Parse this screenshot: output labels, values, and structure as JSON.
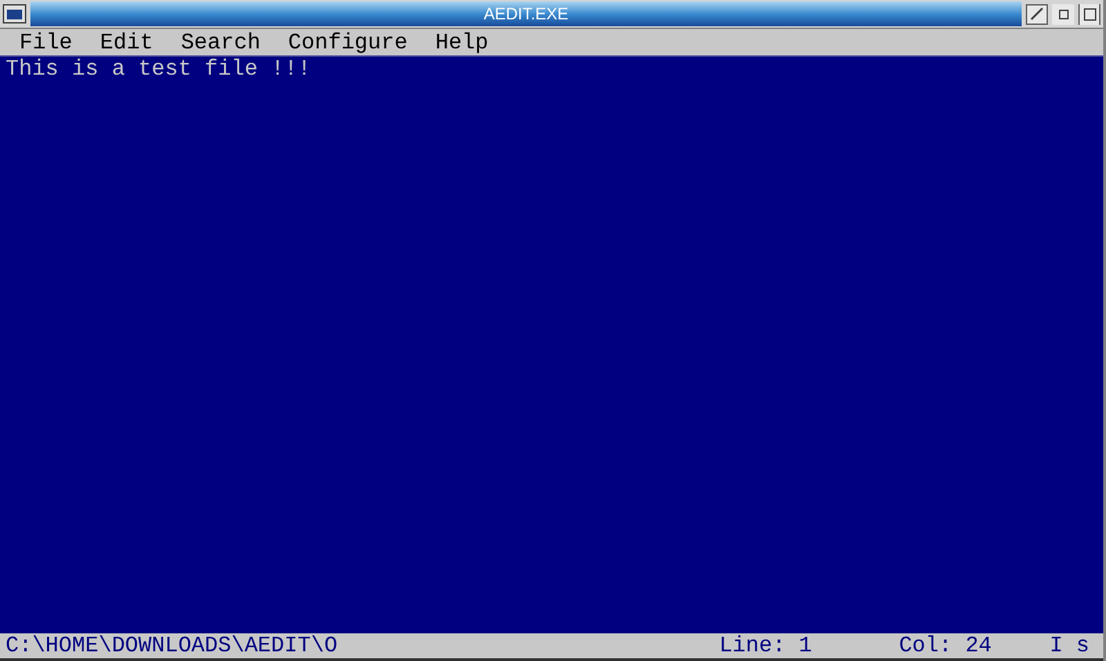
{
  "window": {
    "title": "AEDIT.EXE"
  },
  "menu": [
    "File",
    "Edit",
    "Search",
    "Configure",
    "Help"
  ],
  "editor": {
    "lines": [
      "This is a test file !!!"
    ]
  },
  "status_bar": {
    "path": "C:\\HOME\\DOWNLOADS\\AEDIT\\O",
    "line": "Line: 1",
    "col": "Col: 24",
    "mode": "I s"
  }
}
